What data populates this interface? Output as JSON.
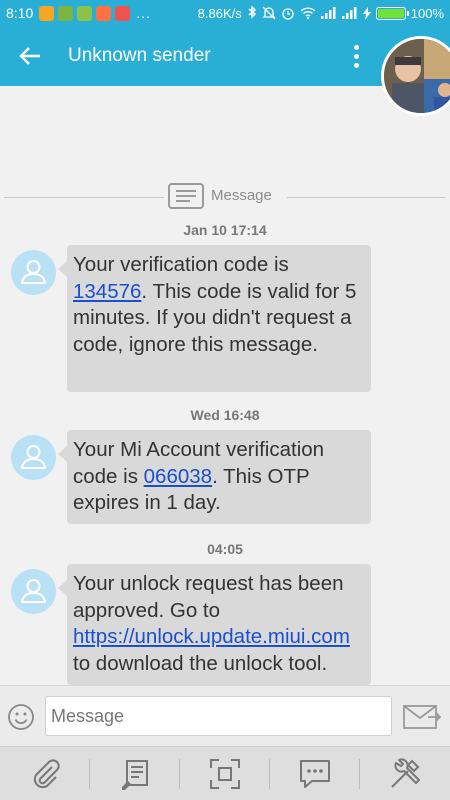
{
  "status_bar": {
    "time": "8:10",
    "more": "...",
    "net_speed": "8.86K/s",
    "battery": "100%",
    "battery_level": 1.0,
    "notif_colors": [
      "#f5a623",
      "#7cb342",
      "#8bc34a",
      "#ff7043",
      "#ef5350"
    ]
  },
  "app_bar": {
    "title": "Unknown sender",
    "back_icon": "arrow-left-icon",
    "menu_icon": "more-vert-icon"
  },
  "conversation": {
    "divider_label": "Message",
    "messages": [
      {
        "timestamp": "Jan 10 17:14",
        "pre": "Your verification code is ",
        "link": "134576",
        "post": ". This code is valid for 5 minutes. If you didn't request a code, ignore this message."
      },
      {
        "timestamp": "Wed 16:48",
        "pre": "Your Mi Account verification code is ",
        "link": "066038",
        "post": ". This OTP expires in 1 day."
      },
      {
        "timestamp": "04:05",
        "pre": "Your unlock request has been approved. Go to ",
        "link": "https://unlock.update.miui.com",
        "post": " to download the unlock tool."
      }
    ]
  },
  "compose": {
    "placeholder": "Message",
    "emoji_icon": "smiley-icon",
    "send_icon": "send-icon"
  },
  "toolbar": {
    "items": [
      "attach-icon",
      "template-icon",
      "expand-icon",
      "quick-reply-icon",
      "tools-icon"
    ]
  },
  "colors": {
    "accent": "#29aed6",
    "bubble": "#d9d9d9",
    "link": "#1a4fd0",
    "contact_avatar": "#b9e1f5"
  }
}
